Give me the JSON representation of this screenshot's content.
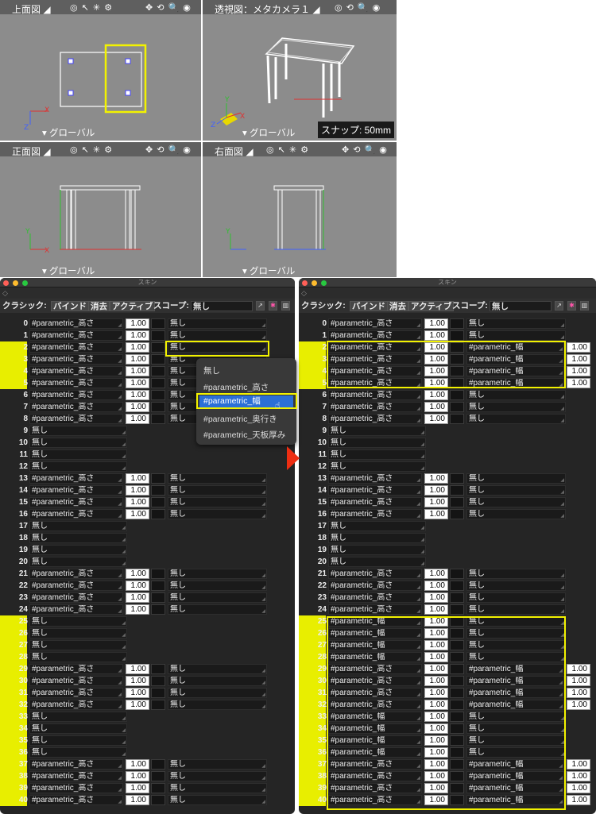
{
  "viewports": {
    "top": {
      "title": "上面図",
      "nav": "グローバル"
    },
    "persp": {
      "title": "透視図：メタカメラ１",
      "nav": "グローバル",
      "snap": "スナップ: 50mm"
    },
    "front": {
      "title": "正面図",
      "nav": "グローバル"
    },
    "right": {
      "title": "右面図",
      "nav": "グローバル"
    }
  },
  "skin_left": {
    "title": "スキン"
  },
  "skin_right": {
    "title": "スキン"
  },
  "toolbar": {
    "mode": "クラシック:",
    "bind": "バインド",
    "erase": "消去",
    "active": "アクティブ",
    "scope_label": "スコープ:",
    "scope_value": "無し"
  },
  "none": "無し",
  "dropdown": {
    "items": [
      "無し",
      "#parametric_高さ",
      "#parametric_幅",
      "#parametric_奥行き",
      "#parametric_天板厚み"
    ],
    "selected_index": 2
  },
  "left_rows": [
    {
      "n": "0",
      "a": "#parametric_高さ",
      "v": "1.00",
      "b": "無し"
    },
    {
      "n": "1",
      "a": "#parametric_高さ",
      "v": "1.00",
      "b": "無し"
    },
    {
      "n": "2",
      "a": "#parametric_高さ",
      "v": "1.00",
      "b": "無し",
      "hl": true
    },
    {
      "n": "3",
      "a": "#parametric_高さ",
      "v": "1.00",
      "b": "無し",
      "hl": true
    },
    {
      "n": "4",
      "a": "#parametric_高さ",
      "v": "1.00",
      "b": "無し",
      "hl": true
    },
    {
      "n": "5",
      "a": "#parametric_高さ",
      "v": "1.00",
      "b": "無し",
      "hl": true
    },
    {
      "n": "6",
      "a": "#parametric_高さ",
      "v": "1.00",
      "b": "無し"
    },
    {
      "n": "7",
      "a": "#parametric_高さ",
      "v": "1.00",
      "b": "無し"
    },
    {
      "n": "8",
      "a": "#parametric_高さ",
      "v": "1.00",
      "b": "無し"
    },
    {
      "n": "9",
      "a": "無し"
    },
    {
      "n": "10",
      "a": "無し"
    },
    {
      "n": "11",
      "a": "無し"
    },
    {
      "n": "12",
      "a": "無し"
    },
    {
      "n": "13",
      "a": "#parametric_高さ",
      "v": "1.00",
      "b": "無し"
    },
    {
      "n": "14",
      "a": "#parametric_高さ",
      "v": "1.00",
      "b": "無し"
    },
    {
      "n": "15",
      "a": "#parametric_高さ",
      "v": "1.00",
      "b": "無し"
    },
    {
      "n": "16",
      "a": "#parametric_高さ",
      "v": "1.00",
      "b": "無し"
    },
    {
      "n": "17",
      "a": "無し"
    },
    {
      "n": "18",
      "a": "無し"
    },
    {
      "n": "19",
      "a": "無し"
    },
    {
      "n": "20",
      "a": "無し"
    },
    {
      "n": "21",
      "a": "#parametric_高さ",
      "v": "1.00",
      "b": "無し"
    },
    {
      "n": "22",
      "a": "#parametric_高さ",
      "v": "1.00",
      "b": "無し"
    },
    {
      "n": "23",
      "a": "#parametric_高さ",
      "v": "1.00",
      "b": "無し"
    },
    {
      "n": "24",
      "a": "#parametric_高さ",
      "v": "1.00",
      "b": "無し"
    },
    {
      "n": "25",
      "a": "無し",
      "hl": true
    },
    {
      "n": "26",
      "a": "無し",
      "hl": true
    },
    {
      "n": "27",
      "a": "無し",
      "hl": true
    },
    {
      "n": "28",
      "a": "無し",
      "hl": true
    },
    {
      "n": "29",
      "a": "#parametric_高さ",
      "v": "1.00",
      "b": "無し",
      "hl": true
    },
    {
      "n": "30",
      "a": "#parametric_高さ",
      "v": "1.00",
      "b": "無し",
      "hl": true
    },
    {
      "n": "31",
      "a": "#parametric_高さ",
      "v": "1.00",
      "b": "無し",
      "hl": true
    },
    {
      "n": "32",
      "a": "#parametric_高さ",
      "v": "1.00",
      "b": "無し",
      "hl": true
    },
    {
      "n": "33",
      "a": "無し",
      "hl": true
    },
    {
      "n": "34",
      "a": "無し",
      "hl": true
    },
    {
      "n": "35",
      "a": "無し",
      "hl": true
    },
    {
      "n": "36",
      "a": "無し",
      "hl": true
    },
    {
      "n": "37",
      "a": "#parametric_高さ",
      "v": "1.00",
      "b": "無し",
      "hl": true
    },
    {
      "n": "38",
      "a": "#parametric_高さ",
      "v": "1.00",
      "b": "無し",
      "hl": true
    },
    {
      "n": "39",
      "a": "#parametric_高さ",
      "v": "1.00",
      "b": "無し",
      "hl": true
    },
    {
      "n": "40",
      "a": "#parametric_高さ",
      "v": "1.00",
      "b": "無し",
      "hl": true
    }
  ],
  "right_rows": [
    {
      "n": "0",
      "a": "#parametric_高さ",
      "v": "1.00",
      "b": "無し"
    },
    {
      "n": "1",
      "a": "#parametric_高さ",
      "v": "1.00",
      "b": "無し"
    },
    {
      "n": "2",
      "a": "#parametric_高さ",
      "v": "1.00",
      "b": "#parametric_幅",
      "v2": "1.00",
      "hl": true
    },
    {
      "n": "3",
      "a": "#parametric_高さ",
      "v": "1.00",
      "b": "#parametric_幅",
      "v2": "1.00",
      "hl": true
    },
    {
      "n": "4",
      "a": "#parametric_高さ",
      "v": "1.00",
      "b": "#parametric_幅",
      "v2": "1.00",
      "hl": true
    },
    {
      "n": "5",
      "a": "#parametric_高さ",
      "v": "1.00",
      "b": "#parametric_幅",
      "v2": "1.00",
      "hl": true
    },
    {
      "n": "6",
      "a": "#parametric_高さ",
      "v": "1.00",
      "b": "無し"
    },
    {
      "n": "7",
      "a": "#parametric_高さ",
      "v": "1.00",
      "b": "無し"
    },
    {
      "n": "8",
      "a": "#parametric_高さ",
      "v": "1.00",
      "b": "無し"
    },
    {
      "n": "9",
      "a": "無し"
    },
    {
      "n": "10",
      "a": "無し"
    },
    {
      "n": "11",
      "a": "無し"
    },
    {
      "n": "12",
      "a": "無し"
    },
    {
      "n": "13",
      "a": "#parametric_高さ",
      "v": "1.00",
      "b": "無し"
    },
    {
      "n": "14",
      "a": "#parametric_高さ",
      "v": "1.00",
      "b": "無し"
    },
    {
      "n": "15",
      "a": "#parametric_高さ",
      "v": "1.00",
      "b": "無し"
    },
    {
      "n": "16",
      "a": "#parametric_高さ",
      "v": "1.00",
      "b": "無し"
    },
    {
      "n": "17",
      "a": "無し"
    },
    {
      "n": "18",
      "a": "無し"
    },
    {
      "n": "19",
      "a": "無し"
    },
    {
      "n": "20",
      "a": "無し"
    },
    {
      "n": "21",
      "a": "#parametric_高さ",
      "v": "1.00",
      "b": "無し"
    },
    {
      "n": "22",
      "a": "#parametric_高さ",
      "v": "1.00",
      "b": "無し"
    },
    {
      "n": "23",
      "a": "#parametric_高さ",
      "v": "1.00",
      "b": "無し"
    },
    {
      "n": "24",
      "a": "#parametric_高さ",
      "v": "1.00",
      "b": "無し"
    },
    {
      "n": "25",
      "a": "#parametric_幅",
      "v": "1.00",
      "b": "無し",
      "hl": true
    },
    {
      "n": "26",
      "a": "#parametric_幅",
      "v": "1.00",
      "b": "無し",
      "hl": true
    },
    {
      "n": "27",
      "a": "#parametric_幅",
      "v": "1.00",
      "b": "無し",
      "hl": true
    },
    {
      "n": "28",
      "a": "#parametric_幅",
      "v": "1.00",
      "b": "無し",
      "hl": true
    },
    {
      "n": "29",
      "a": "#parametric_高さ",
      "v": "1.00",
      "b": "#parametric_幅",
      "v2": "1.00",
      "hl": true
    },
    {
      "n": "30",
      "a": "#parametric_高さ",
      "v": "1.00",
      "b": "#parametric_幅",
      "v2": "1.00",
      "hl": true
    },
    {
      "n": "31",
      "a": "#parametric_高さ",
      "v": "1.00",
      "b": "#parametric_幅",
      "v2": "1.00",
      "hl": true
    },
    {
      "n": "32",
      "a": "#parametric_高さ",
      "v": "1.00",
      "b": "#parametric_幅",
      "v2": "1.00",
      "hl": true
    },
    {
      "n": "33",
      "a": "#parametric_幅",
      "v": "1.00",
      "b": "無し",
      "hl": true
    },
    {
      "n": "34",
      "a": "#parametric_幅",
      "v": "1.00",
      "b": "無し",
      "hl": true
    },
    {
      "n": "35",
      "a": "#parametric_幅",
      "v": "1.00",
      "b": "無し",
      "hl": true
    },
    {
      "n": "36",
      "a": "#parametric_幅",
      "v": "1.00",
      "b": "無し",
      "hl": true
    },
    {
      "n": "37",
      "a": "#parametric_高さ",
      "v": "1.00",
      "b": "#parametric_幅",
      "v2": "1.00",
      "hl": true
    },
    {
      "n": "38",
      "a": "#parametric_高さ",
      "v": "1.00",
      "b": "#parametric_幅",
      "v2": "1.00",
      "hl": true
    },
    {
      "n": "39",
      "a": "#parametric_高さ",
      "v": "1.00",
      "b": "#parametric_幅",
      "v2": "1.00",
      "hl": true
    },
    {
      "n": "40",
      "a": "#parametric_高さ",
      "v": "1.00",
      "b": "#parametric_幅",
      "v2": "1.00",
      "hl": true
    }
  ],
  "colors": {
    "highlight": "#e8ee00",
    "selection": "#2b6fd6",
    "arrow": "#ee2e12",
    "axis_x": "#e03030",
    "axis_y": "#30c030",
    "axis_z": "#4060ff"
  }
}
